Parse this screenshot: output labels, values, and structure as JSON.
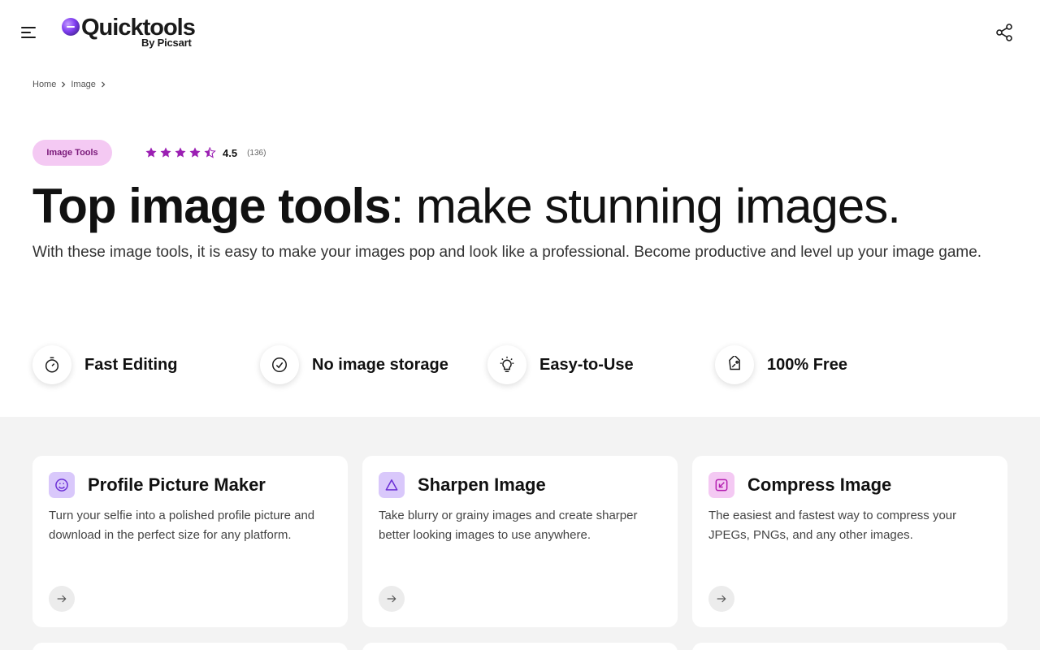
{
  "header": {
    "menu_icon": "hamburger-menu-icon",
    "logo_text": "Quicktools",
    "logo_sub": "By Picsart",
    "share_icon": "share-icon"
  },
  "breadcrumb": {
    "items": [
      {
        "label": "Home"
      },
      {
        "label": "Image"
      }
    ],
    "separator_icon": "chevron-right-icon"
  },
  "category": {
    "label": "Image Tools",
    "color": "#f4c9f3",
    "text_color": "#7a1a7a"
  },
  "rating": {
    "value": "4.5",
    "count": "(136)",
    "stars": 4.5,
    "max_stars": 5,
    "star_color": "#9b1fb3"
  },
  "hero": {
    "title_strong": "Top image tools",
    "title_rest": ": make stunning images.",
    "description": "With these image tools, it is easy to make your images pop and look like a professional. Become productive and level up your image game."
  },
  "features": [
    {
      "label": "Fast Editing",
      "icon": "stopwatch-icon"
    },
    {
      "label": "No image storage",
      "icon": "check-circle-icon"
    },
    {
      "label": "Easy-to-Use",
      "icon": "lightbulb-icon"
    },
    {
      "label": "100% Free",
      "icon": "price-tag-icon"
    }
  ],
  "cards": [
    {
      "title": "Profile Picture Maker",
      "description": "Turn your selfie into a polished profile picture and download in the perfect size for any platform.",
      "icon": "smiley-face-icon",
      "icon_bg": "#d9c8fb"
    },
    {
      "title": "Sharpen Image",
      "description": "Take blurry or grainy images and create sharper better looking images to use anywhere.",
      "icon": "triangle-icon",
      "icon_bg": "#d9c8fb"
    },
    {
      "title": "Compress Image",
      "description": "The easiest and fastest way to compress your JPEGs, PNGs, and any other images.",
      "icon": "compress-arrow-icon",
      "icon_bg": "#f4c9f3"
    }
  ],
  "colors": {
    "section_bg": "#f3f3f3",
    "card_bg": "#ffffff",
    "accent_purple": "#9b1fb3"
  }
}
